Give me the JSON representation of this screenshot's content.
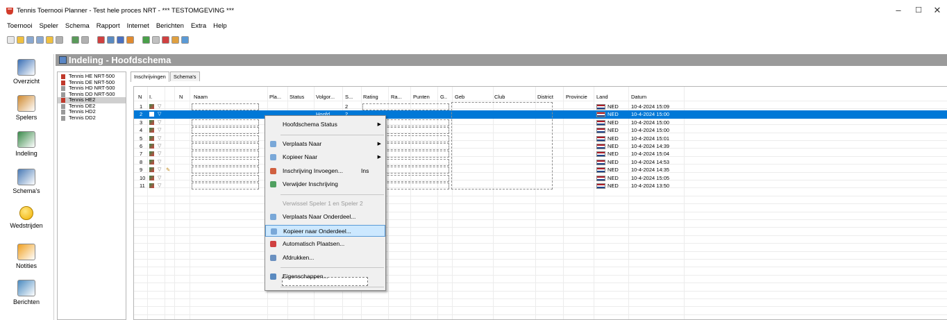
{
  "window": {
    "title": "Tennis Toernooi Planner - Test hele proces NRT - *** TESTOMGEVING ***",
    "controls": {
      "minimize": "–",
      "maximize": "☐",
      "close": "✕"
    }
  },
  "menubar": [
    "Toernooi",
    "Speler",
    "Schema",
    "Rapport",
    "Internet",
    "Berichten",
    "Extra",
    "Help"
  ],
  "toolbar_icons": [
    "new-icon",
    "open-icon",
    "players-icon",
    "players2-icon",
    "edit-icon",
    "print-icon",
    "globe-icon",
    "mail-icon",
    "person-red-icon",
    "person-group-icon",
    "person-blue-icon",
    "person-orange-icon",
    "schedule-icon",
    "schedule2-icon",
    "schedule3-icon",
    "court-icon",
    "court2-icon"
  ],
  "nav": [
    {
      "label": "Overzicht",
      "icon": "overview-icon"
    },
    {
      "label": "Spelers",
      "icon": "players-icon"
    },
    {
      "label": "Indeling",
      "icon": "draw-icon"
    },
    {
      "label": "Schema's",
      "icon": "schedule-icon"
    },
    {
      "label": "Wedstrijden",
      "icon": "match-icon"
    },
    {
      "label": "Notities",
      "icon": "note-icon"
    },
    {
      "label": "Berichten",
      "icon": "message-icon"
    }
  ],
  "header": {
    "title": "Indeling - Hoofdschema"
  },
  "tree": [
    {
      "label": "Tennis HE NRT-500",
      "color": "#c0392b",
      "selected": false
    },
    {
      "label": "Tennis DE NRT-500",
      "color": "#c0392b",
      "selected": false
    },
    {
      "label": "Tennis HD NRT-500",
      "color": "#9a9a9a",
      "selected": false
    },
    {
      "label": "Tennis DD NRT-500",
      "color": "#9a9a9a",
      "selected": false
    },
    {
      "label": "Tennis HE2",
      "color": "#c0392b",
      "selected": true
    },
    {
      "label": "Tennis DE2",
      "color": "#9a9a9a",
      "selected": false
    },
    {
      "label": "Tennis HD2",
      "color": "#9a9a9a",
      "selected": false
    },
    {
      "label": "Tennis DD2",
      "color": "#9a9a9a",
      "selected": false
    }
  ],
  "tabs": [
    {
      "label": "Inschrijvingen",
      "active": true
    },
    {
      "label": "Schema's",
      "active": false
    }
  ],
  "columns": [
    "N",
    "I.",
    "N",
    "Naam",
    "Pla...",
    "Status",
    "Volgor...",
    "S...",
    "Rating",
    "Ra...",
    "Punten",
    "G..",
    "Geb",
    "Club",
    "District",
    "Provincie",
    "Land",
    "Datum"
  ],
  "rows": [
    {
      "n": "1",
      "s": "2",
      "volgorde": "",
      "land": "NED",
      "datum": "10-4-2024 15:09",
      "selected": false,
      "pencil": false
    },
    {
      "n": "2",
      "s": "2",
      "volgorde": "Hoofd",
      "land": "NED",
      "datum": "10-4-2024 15:00",
      "selected": true,
      "pencil": false
    },
    {
      "n": "3",
      "s": "",
      "volgorde": "",
      "land": "NED",
      "datum": "10-4-2024 15:00",
      "selected": false,
      "pencil": false
    },
    {
      "n": "4",
      "s": "",
      "volgorde": "",
      "land": "NED",
      "datum": "10-4-2024 15:00",
      "selected": false,
      "pencil": false
    },
    {
      "n": "5",
      "s": "",
      "volgorde": "",
      "land": "NED",
      "datum": "10-4-2024 15:01",
      "selected": false,
      "pencil": false
    },
    {
      "n": "6",
      "s": "",
      "volgorde": "",
      "land": "NED",
      "datum": "10-4-2024 14:39",
      "selected": false,
      "pencil": false
    },
    {
      "n": "7",
      "s": "",
      "volgorde": "",
      "land": "NED",
      "datum": "10-4-2024 15:04",
      "selected": false,
      "pencil": false
    },
    {
      "n": "8",
      "s": "",
      "volgorde": "",
      "land": "NED",
      "datum": "10-4-2024 14:53",
      "selected": false,
      "pencil": false
    },
    {
      "n": "9",
      "s": "",
      "volgorde": "",
      "land": "NED",
      "datum": "10-4-2024 14:35",
      "selected": false,
      "pencil": true
    },
    {
      "n": "10",
      "s": "",
      "volgorde": "",
      "land": "NED",
      "datum": "10-4-2024 15:05",
      "selected": false,
      "pencil": false
    },
    {
      "n": "11",
      "s": "",
      "volgorde": "",
      "land": "NED",
      "datum": "10-4-2024 13:50",
      "selected": false,
      "pencil": false
    }
  ],
  "context_menu": [
    {
      "type": "item",
      "label": "Hoofdschema Status",
      "submenu": true,
      "icon": ""
    },
    {
      "type": "sep"
    },
    {
      "type": "item",
      "label": "Verplaats Naar",
      "submenu": true,
      "icon": "move-icon"
    },
    {
      "type": "item",
      "label": "Kopieer Naar",
      "submenu": true,
      "icon": "copy-icon"
    },
    {
      "type": "item",
      "label": "Inschrijving Invoegen...",
      "shortcut": "Ins",
      "icon": "insert-person-icon"
    },
    {
      "type": "item",
      "label": "Verwijder Inschrijving",
      "icon": "delete-icon"
    },
    {
      "type": "sep"
    },
    {
      "type": "item",
      "label": "Verwissel Speler 1 en Speler 2",
      "disabled": true,
      "icon": ""
    },
    {
      "type": "item",
      "label": "Verplaats Naar Onderdeel...",
      "icon": "move-icon"
    },
    {
      "type": "item",
      "label": "Kopieer naar Onderdeel...",
      "hover": true,
      "icon": "copy-icon"
    },
    {
      "type": "item",
      "label": "Automatisch Plaatsen...",
      "icon": "auto-place-icon"
    },
    {
      "type": "item",
      "label": "Afdrukken...",
      "icon": "print-icon"
    },
    {
      "type": "sep"
    },
    {
      "type": "item",
      "label": "Eigenschappen...",
      "icon": "properties-icon"
    },
    {
      "type": "sep"
    }
  ],
  "colors": {
    "selection": "#0078d7",
    "header_band": "#9a9a9a",
    "menu_hover": "#cce8ff"
  }
}
